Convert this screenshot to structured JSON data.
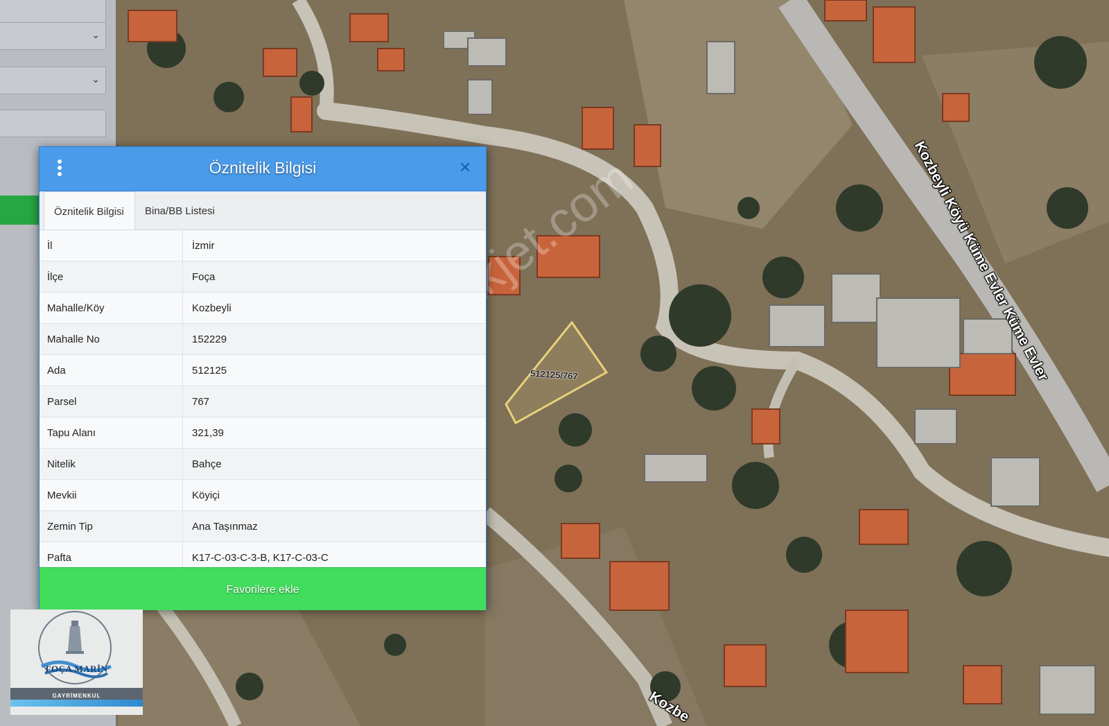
{
  "dialog": {
    "title": "Öznitelik Bilgisi",
    "close_icon": "close-icon",
    "menu_icon": "vertical-dots-icon",
    "tabs": [
      {
        "label": "Öznitelik Bilgisi",
        "active": true
      },
      {
        "label": "Bina/BB Listesi",
        "active": false
      }
    ],
    "rows": [
      {
        "key": "İl",
        "value": "İzmir"
      },
      {
        "key": "İlçe",
        "value": "Foça"
      },
      {
        "key": "Mahalle/Köy",
        "value": "Kozbeyli"
      },
      {
        "key": "Mahalle No",
        "value": "152229"
      },
      {
        "key": "Ada",
        "value": "512125"
      },
      {
        "key": "Parsel",
        "value": "767"
      },
      {
        "key": "Tapu Alanı",
        "value": "321,39"
      },
      {
        "key": "Nitelik",
        "value": "Bahçe"
      },
      {
        "key": "Mevkii",
        "value": "Köyiçi"
      },
      {
        "key": "Zemin Tip",
        "value": "Ana Taşınmaz"
      },
      {
        "key": "Pafta",
        "value": "K17-C-03-C-3-B, K17-C-03-C"
      }
    ],
    "favorite_button": "Favorilere ekle"
  },
  "map": {
    "parcel_label": "512125/767",
    "road_label_1": "Kozbeyli Köyü Küme Evler Küme Evler",
    "road_label_2": "Kozbe",
    "watermark": "emlakjet.com"
  },
  "logo": {
    "name": "FOÇA MARİN",
    "subtitle": "GAYRİMENKUL"
  },
  "colors": {
    "header_blue": "#4a9be9",
    "favorite_green": "#41dd5c",
    "parcel_outline": "#e8d27a"
  }
}
